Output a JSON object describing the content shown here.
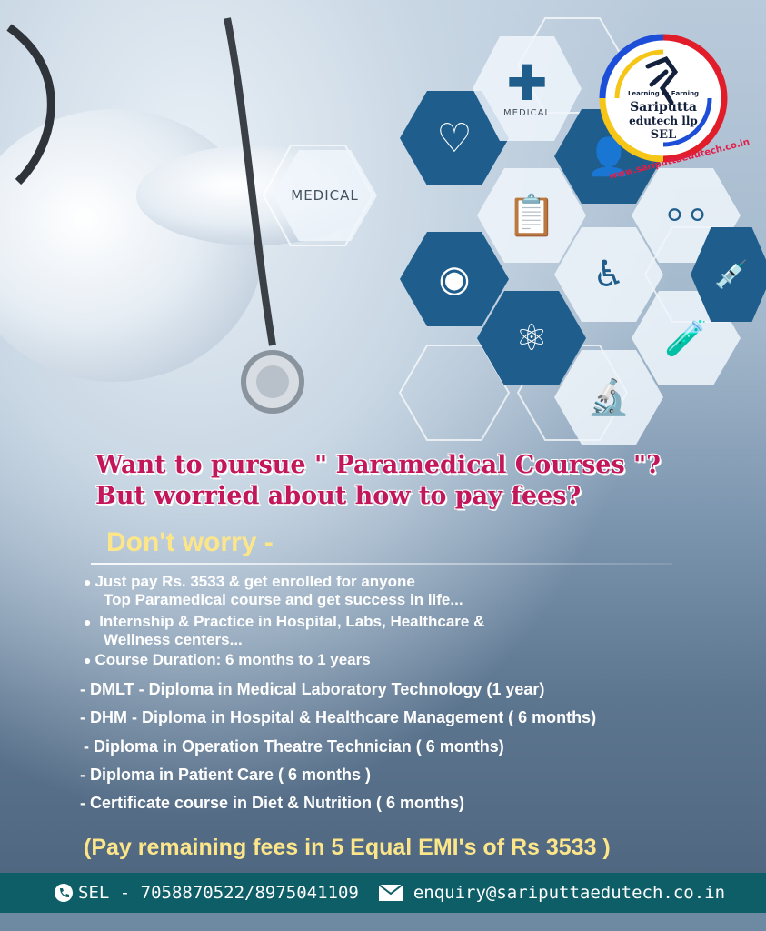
{
  "logo": {
    "tagline": "Learning to Earning",
    "name_line1": "Sariputta",
    "name_line2": "edutech llp",
    "abbr": "SEL",
    "url": "www.sariputtaedutech.co.in"
  },
  "hex_labels": {
    "medical_big": "MEDICAL",
    "medical_small": "MEDICAL"
  },
  "headline": {
    "line1": "Want to pursue \" Paramedical Courses \"?",
    "line2": "But worried about how to pay fees?"
  },
  "subhead": "Don't worry -",
  "bullets": [
    {
      "line1": "Just pay Rs. 3533  & get enrolled for anyone",
      "line2": "Top Paramedical course and get success in life..."
    },
    {
      "line1": "Internship & Practice in Hospital, Labs, Healthcare &",
      "line2": "Wellness centers..."
    },
    {
      "line1": "Course Duration: 6 months to 1 years",
      "line2": ""
    }
  ],
  "courses": [
    "- DMLT - Diploma in Medical Laboratory Technology (1 year)",
    "- DHM - Diploma in Hospital & Healthcare Management ( 6 months)",
    "- Diploma in Operation Theatre Technician ( 6 months)",
    "- Diploma in Patient Care ( 6 months )",
    "- Certificate course in Diet & Nutrition ( 6 months)"
  ],
  "emi_note": "(Pay remaining fees in 5 Equal EMI's of Rs 3533 )",
  "footer": {
    "phone": "SEL - 7058870522/8975041109",
    "email": "enquiry@sariputtaedutech.co.in"
  },
  "colors": {
    "headline": "#c2185b",
    "accent_yellow": "#fde68a",
    "footer_bg": "#0e5e67",
    "hex_dark": "#1f5d8c"
  }
}
